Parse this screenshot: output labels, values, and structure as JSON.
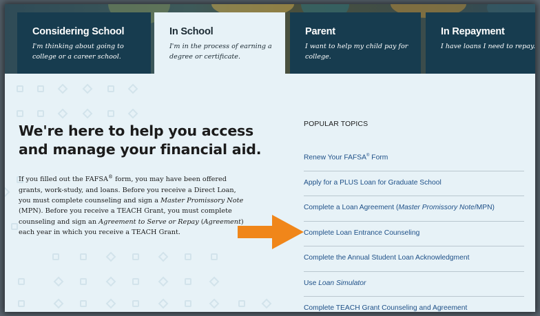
{
  "colors": {
    "tab_bg": "#173c4f",
    "active_tab_bg": "#e7f2f7",
    "page_bg": "#e7f2f7",
    "link": "#1d4f87",
    "arrow": "#f0861a"
  },
  "tabs": [
    {
      "title": "Considering School",
      "desc": "I'm thinking about going to college or a career school.",
      "active": false
    },
    {
      "title": "In School",
      "desc": "I'm in the process of earning a degree or certificate.",
      "active": true
    },
    {
      "title": "Parent",
      "desc": "I want to help my child pay for college.",
      "active": false
    },
    {
      "title": "In Repayment",
      "desc": "I have loans I need to repay.",
      "active": false
    }
  ],
  "main": {
    "heading": "We're here to help you access and manage your financial aid.",
    "intro": {
      "p1": "If you filled out the FAFSA",
      "reg": "®",
      "p2": " form, you may have been offered grants, work-study, and loans. Before you receive a Direct Loan, you must complete counseling and sign a ",
      "em1": "Master Promissory Note",
      "p3": " (MPN). Before you receive a TEACH Grant, you must complete counseling and sign an ",
      "em2": "Agreement to Serve or Repay",
      "p4": " (",
      "em3": "Agreement",
      "p5": ") each year in which you receive a TEACH Grant."
    }
  },
  "arrow_icon": "orange-right-arrow",
  "popular_topics": {
    "heading": "POPULAR TOPICS",
    "items": [
      {
        "a": "Renew Your FAFSA",
        "sup": "®",
        "b": " Form"
      },
      {
        "a": "Apply for a PLUS Loan for Graduate School"
      },
      {
        "a": "Complete a Loan Agreement (",
        "em": "Master Promissory Note",
        "b": "/MPN)"
      },
      {
        "a": "Complete Loan Entrance Counseling"
      },
      {
        "a": "Complete the Annual Student Loan Acknowledgment"
      },
      {
        "a": "Use ",
        "em": "Loan Simulator"
      },
      {
        "a": "Complete TEACH Grant Counseling and Agreement"
      }
    ]
  }
}
